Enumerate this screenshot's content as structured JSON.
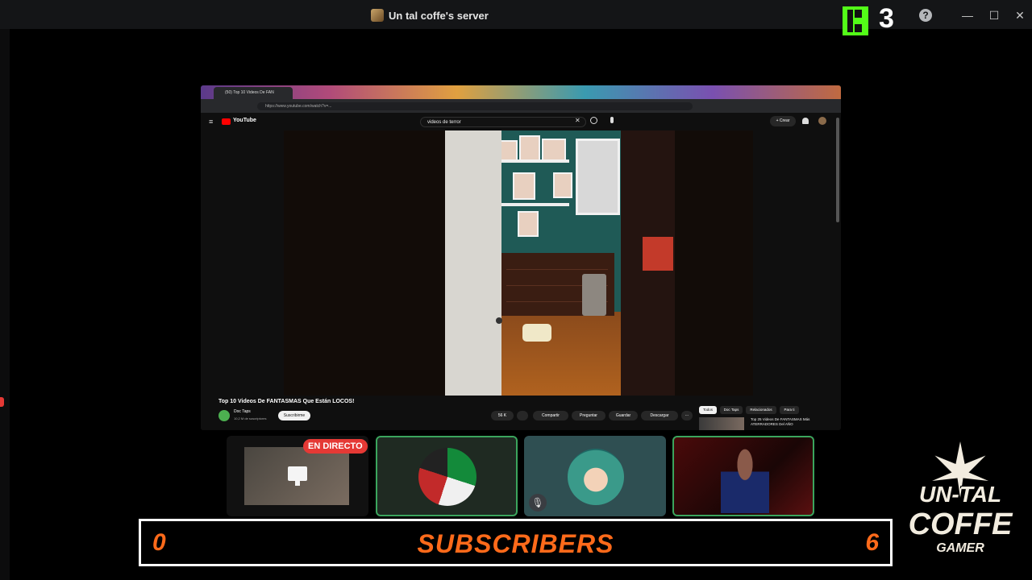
{
  "window": {
    "title": "Un tal coffe's server",
    "kick_count": "3",
    "help_glyph": "?",
    "minimize_glyph": "—",
    "maximize_glyph": "☐",
    "close_glyph": "✕",
    "icons": [
      "server-icon",
      "kick-logo-icon",
      "help-icon",
      "minimize-icon",
      "maximize-icon",
      "close-icon"
    ]
  },
  "stream": {
    "browser": {
      "tab_title": "(50) Top 10 Videos De FAN",
      "url": "https://www.youtube.com/watch?v=..."
    },
    "youtube": {
      "logo_text": "YouTube",
      "search_value": "videos de terror",
      "clear_glyph": "✕",
      "create_label": "+ Crear",
      "video_title": "Top 10 Videos De FANTASMAS Que Están LOCOS!",
      "channel_name": "Doc Taps",
      "channel_subs": "10,2 M de suscriptores",
      "subscribe_label": "Suscribirme",
      "actions": [
        "56 K",
        "",
        "Compartir",
        "Preguntar",
        "Guardar",
        "Descargar",
        "···"
      ],
      "chips": [
        "Todos",
        "Doc Taps",
        "Relacionados",
        "Para ti"
      ],
      "recommended_title": "Top 25 Videos De FANTASMAS Más ATERRADORES Del AÑO"
    }
  },
  "participants": {
    "live_badge": "EN DIRECTO",
    "tiles": [
      "screen-share",
      "mexico-flag-avatar",
      "anime-avatar",
      "webcam"
    ],
    "mute_glyph": "🎙"
  },
  "subscribers": {
    "left_value": "0",
    "label": "SUBSCRIBERS",
    "right_value": "6",
    "color": "#ff6a1a"
  },
  "brand": {
    "line1": "UN-TAL",
    "line2": "COFFE",
    "line3": "GAMER"
  }
}
